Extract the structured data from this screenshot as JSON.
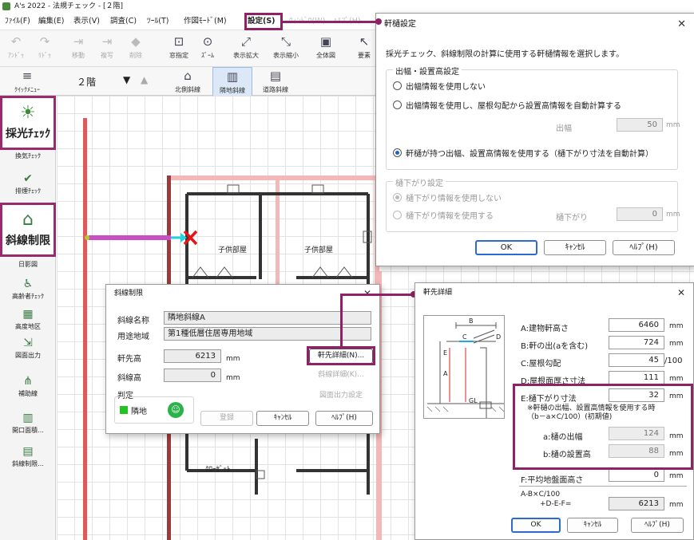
{
  "app": {
    "title": "A's 2022 - 法規チェック - [２階]",
    "menu": [
      "ﾌｧｲﾙ(F)",
      "編集(E)",
      "表示(V)",
      "調査(C)",
      "ﾂｰﾙ(T)",
      "作図ﾓｰﾄﾞ(M)",
      "設定(S)",
      "ｳｨﾝﾄﾞｳ(W)",
      "ﾍﾙﾌﾟ(H)"
    ],
    "toolbar": [
      "ｱﾝﾄﾞｩ",
      "ﾘﾄﾞｩ",
      "移動",
      "複写",
      "削除",
      "窓指定",
      "ｽﾞｰﾑ",
      "表示拡大",
      "表示縮小",
      "全体図",
      "要素"
    ],
    "floor": {
      "quick_menu": "ｸｲｯｸﾒﾆｭｰ",
      "level": "２階"
    },
    "setback_tabs": [
      "北側斜線",
      "隣地斜線",
      "道路斜線"
    ],
    "left_rail": {
      "daylight": "採光ﾁｪｯｸ",
      "ventilation": "換気ﾁｪｯｸ",
      "smoke": "排煙ﾁｪｯｸ",
      "setback": "斜線制限",
      "items": [
        "日影図",
        "高齢者ﾁｪｯｸ",
        "高度地区",
        "図面出力",
        "補助線",
        "開口面積...",
        "斜線制限..."
      ]
    }
  },
  "plan": {
    "rooms": [
      "子供部屋",
      "子供部屋"
    ],
    "closet": "ｸﾛｰｾﾞｯﾄ"
  },
  "eaves_dialog": {
    "title": "軒樋設定",
    "description": "採光チェック、斜線制限の計算に使用する軒樋情報を選択します。",
    "group1": {
      "title": "出幅・設置高設定",
      "options": [
        "出幅情報を使用しない",
        "出幅情報を使用し、屋根勾配から設置高情報を自動計算する",
        "軒樋が持つ出幅、設置高情報を使用する（樋下がり寸法を自動計算）"
      ],
      "selected": 2,
      "width_label": "出幅",
      "width_value": "50",
      "unit": "mm"
    },
    "group2": {
      "title": "樋下がり設定",
      "options": [
        "樋下がり情報を使用しない",
        "樋下がり情報を使用する"
      ],
      "selected": 0,
      "drop_label": "樋下がり",
      "drop_value": "0",
      "unit": "mm"
    },
    "buttons": {
      "ok": "OK",
      "cancel": "ｷｬﾝｾﾙ",
      "help": "ﾍﾙﾌﾟ(H)"
    }
  },
  "setback_dialog": {
    "title": "斜線制限",
    "name_label": "斜線名称",
    "name_value": "隣地斜線A",
    "zone_label": "用途地域",
    "zone_value": "第1種低層住居専用地域",
    "eaves_label": "軒先高",
    "eaves_value": "6213",
    "slope_label": "斜線高",
    "slope_value": "0",
    "unit": "mm",
    "judgement_label": "判定",
    "judgement_value": "隣地",
    "buttons": {
      "eaves_detail": "軒先詳細(N)...",
      "slope_detail": "斜線詳細(K)...",
      "drawing_output": "図面出力設定",
      "register": "登録",
      "cancel": "ｷｬﾝｾﾙ",
      "help": "ﾍﾙﾌﾟ(H)"
    }
  },
  "eaves_detail_dialog": {
    "title": "軒先詳細",
    "diagram_labels": {
      "b": "B",
      "c": "C",
      "d": "D",
      "e": "E",
      "a": "A",
      "gl": "GL"
    },
    "rows": [
      {
        "label": "A:建物軒高さ",
        "value": "6460",
        "unit": "mm"
      },
      {
        "label": "B:軒の出(aを含む)",
        "value": "724",
        "unit": "mm"
      },
      {
        "label": "C:屋根勾配",
        "value": "45",
        "unit": "/100"
      },
      {
        "label": "D:屋根面厚さ寸法",
        "value": "111",
        "unit": "mm"
      },
      {
        "label": "E:樋下がり寸法",
        "value": "32",
        "unit": "mm"
      }
    ],
    "note": "※軒樋の出幅、設置高情報を使用する時\n（b－a×C/100）(初期値)",
    "sub_rows": [
      {
        "label": "a:樋の出幅",
        "value": "124",
        "unit": "mm"
      },
      {
        "label": "b:樋の設置高",
        "value": "88",
        "unit": "mm"
      }
    ],
    "f_row": {
      "label": "F:平均地盤面高さ",
      "value": "0",
      "unit": "mm"
    },
    "formula": {
      "line1": "A-B×C/100",
      "line2": "+D-E-F=",
      "value": "6213",
      "unit": "mm"
    },
    "buttons": {
      "ok": "OK",
      "cancel": "ｷｬﾝｾﾙ",
      "help": "ﾍﾙﾌﾟ(H)"
    }
  },
  "colors": {
    "highlight": "#8e2264",
    "accent": "#2b6bd1",
    "wall_red": "#e05050",
    "setback_line": "#c94fc4"
  }
}
